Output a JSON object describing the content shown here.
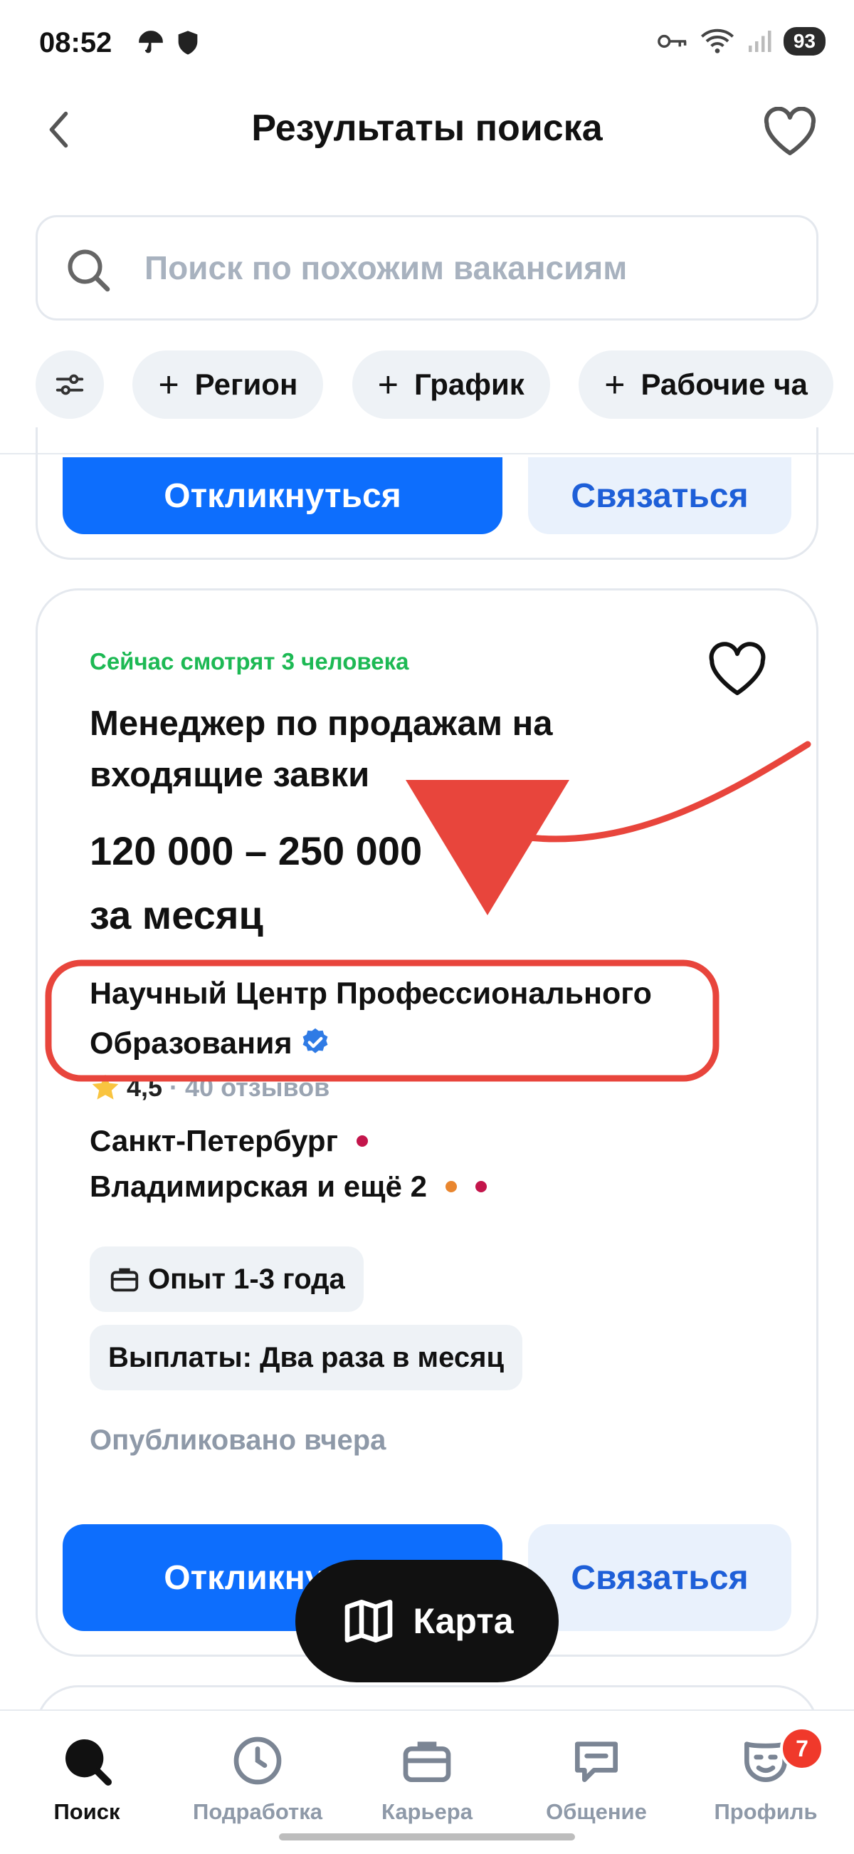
{
  "status_bar": {
    "time": "08:52",
    "battery": "93"
  },
  "header": {
    "title": "Результаты поиска"
  },
  "search": {
    "placeholder": "Поиск по похожим вакансиям"
  },
  "chips": [
    "Регион",
    "График",
    "Рабочие ча"
  ],
  "previous_card": {
    "apply_label": "Откликнуться",
    "contact_label": "Связаться"
  },
  "vacancy": {
    "watching_now": "Сейчас смотрят 3 человека",
    "title": "Менеджер по продажам на входящие завки",
    "salary": "120 000 – 250 000",
    "salary_period": "за месяц",
    "company": "Научный Центр Профессионального Образования",
    "rating": "4,5",
    "reviews": "· 40 отзывов",
    "city": "Санкт-Петербург",
    "metro": "Владимирская и ещё 2",
    "experience": "Опыт 1-3 года",
    "payments": "Выплаты: Два раза в месяц",
    "published": "Опубликовано вчера",
    "apply_label": "Откликнуться",
    "contact_label": "Связаться"
  },
  "map_button": {
    "label": "Карта"
  },
  "bottom_nav": {
    "items": [
      {
        "label": "Поиск",
        "icon": "search-icon",
        "active": true
      },
      {
        "label": "Подработка",
        "icon": "clock-icon",
        "active": false
      },
      {
        "label": "Карьера",
        "icon": "briefcase-icon",
        "active": false
      },
      {
        "label": "Общение",
        "icon": "chat-icon",
        "active": false
      },
      {
        "label": "Профиль",
        "icon": "mask-icon",
        "active": false,
        "badge": "7"
      }
    ]
  },
  "colors": {
    "primary": "#0d6efd",
    "secondary_bg": "#e9f1fc",
    "watching_green": "#1db954",
    "annotation_red": "#e8453c",
    "badge_red": "#f0392b"
  }
}
